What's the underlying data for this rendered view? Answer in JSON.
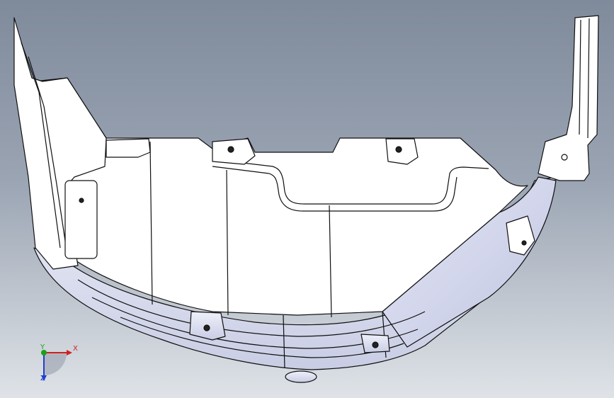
{
  "viewport": {
    "background_top": "#7f8a9b",
    "background_bottom": "#dfe3e8",
    "model_fill": "#ffffff",
    "model_shade": "#d9dcef",
    "edge_color": "#101010"
  },
  "triad": {
    "x_label": "X",
    "y_label": "Y",
    "z_label": "Z",
    "x_color": "#d21f1f",
    "y_color": "#1aa01a",
    "z_color": "#1f3fd2"
  }
}
